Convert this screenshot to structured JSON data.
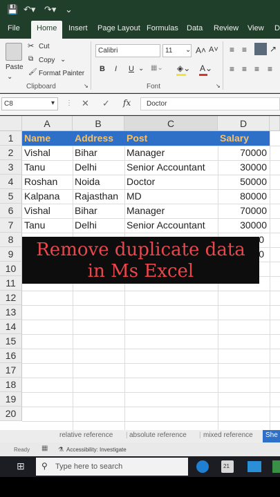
{
  "menu": {
    "tabs": [
      "File",
      "Home",
      "Insert",
      "Page Layout",
      "Formulas",
      "Data",
      "Review",
      "View",
      "D"
    ]
  },
  "ribbon": {
    "clipboard": {
      "cut": "Cut",
      "copy": "Copy",
      "format_painter": "Format Painter",
      "paste": "Paste",
      "group_label": "Clipboard"
    },
    "font": {
      "name": "Calibri",
      "size": "11",
      "grow": "A˄",
      "shrink": "A˅",
      "bold": "B",
      "italic": "I",
      "underline": "U",
      "group_label": "Font"
    }
  },
  "formula_bar": {
    "name_box": "C8",
    "fx": "fx",
    "value": "Doctor"
  },
  "sheet": {
    "columns": [
      "A",
      "B",
      "C",
      "D"
    ],
    "rows": [
      "1",
      "2",
      "3",
      "4",
      "5",
      "6",
      "7",
      "8",
      "9",
      "10",
      "11",
      "12",
      "13",
      "14",
      "15",
      "16",
      "17",
      "18",
      "19",
      "20"
    ],
    "header": [
      "Name",
      "Address",
      "Post",
      "Salary"
    ],
    "data": [
      [
        "Vishal",
        "Bihar",
        "Manager",
        "70000"
      ],
      [
        "Tanu",
        "Delhi",
        "Senior Accountant",
        "30000"
      ],
      [
        "Roshan",
        "Noida",
        "Doctor",
        "50000"
      ],
      [
        "Kalpana",
        "Rajasthan",
        "MD",
        "80000"
      ],
      [
        "Vishal",
        "Bihar",
        "Manager",
        "70000"
      ],
      [
        "Tanu",
        "Delhi",
        "Senior Accountant",
        "30000"
      ]
    ],
    "partial": [
      "0",
      "0"
    ]
  },
  "overlay": {
    "line1": "Remove duplicate data",
    "line2": "in Ms Excel"
  },
  "sheet_tabs": [
    "relative reference",
    "absolute reference",
    "mixed reference",
    "She"
  ],
  "status": {
    "ready": "Ready",
    "accessibility": "Accessibility: Investigate"
  },
  "taskbar": {
    "search_placeholder": "Type here to search",
    "badge": "21"
  },
  "colors": {
    "excel_green": "#1f3f2a",
    "header_fill": "#2e6fc7",
    "header_text": "#f7c36a",
    "overlay_text": "#e8474b"
  }
}
